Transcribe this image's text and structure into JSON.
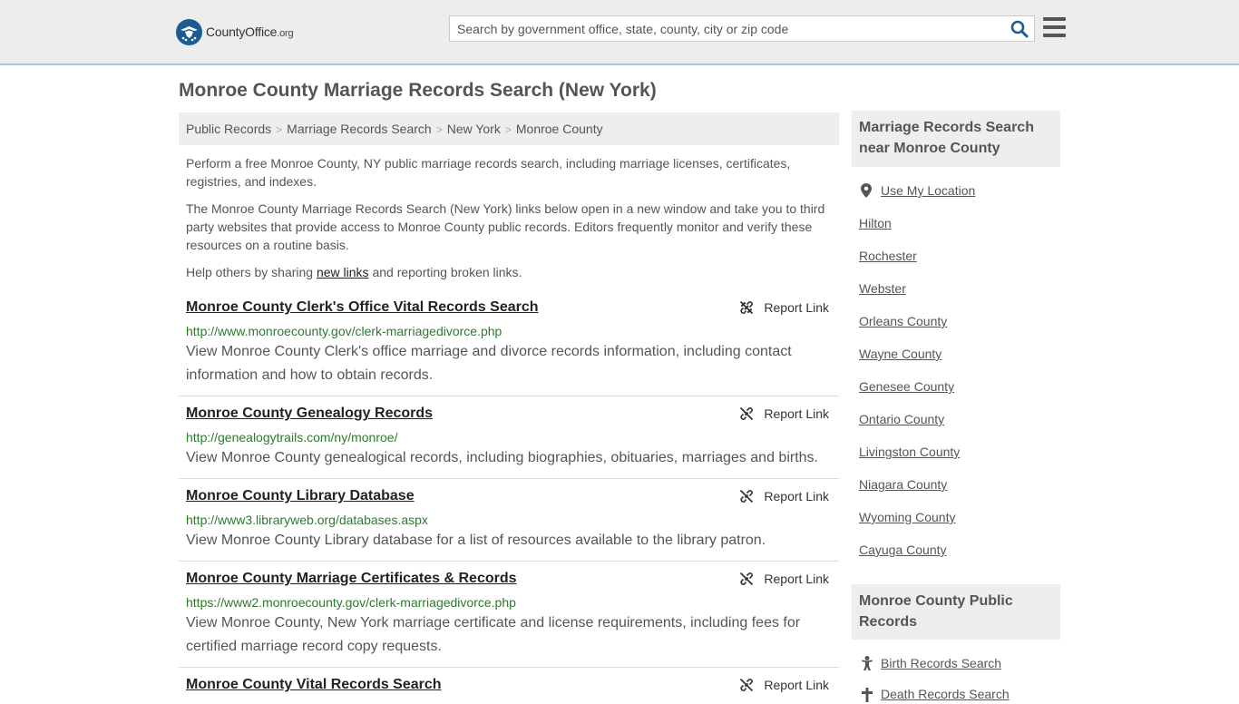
{
  "header": {
    "logo_main": "CountyOffice",
    "logo_tld": ".org",
    "search_placeholder": "Search by government office, state, county, city or zip code",
    "search_icon": "search-icon",
    "menu_icon": "hamburger-menu-icon"
  },
  "page_title": "Monroe County Marriage Records Search (New York)",
  "breadcrumb": [
    "Public Records",
    "Marriage Records Search",
    "New York",
    "Monroe County"
  ],
  "intro": {
    "p1": "Perform a free Monroe County, NY public marriage records search, including marriage licenses, certificates, registries, and indexes.",
    "p2": "The Monroe County Marriage Records Search (New York) links below open in a new window and take you to third party websites that provide access to Monroe County public records. Editors frequently monitor and verify these resources on a routine basis.",
    "p3_before": "Help others by sharing ",
    "p3_link": "new links",
    "p3_after": " and reporting broken links."
  },
  "report_label": "Report Link",
  "results": [
    {
      "title": "Monroe County Clerk's Office Vital Records Search",
      "url": "http://www.monroecounty.gov/clerk-marriagedivorce.php",
      "desc": "View Monroe County Clerk's office marriage and divorce records information, including contact information and how to obtain records."
    },
    {
      "title": "Monroe County Genealogy Records",
      "url": "http://genealogytrails.com/ny/monroe/",
      "desc": "View Monroe County genealogical records, including biographies, obituaries, marriages and births."
    },
    {
      "title": "Monroe County Library Database",
      "url": "http://www3.libraryweb.org/databases.aspx",
      "desc": "View Monroe County Library database for a list of resources available to the library patron."
    },
    {
      "title": "Monroe County Marriage Certificates & Records",
      "url": "https://www2.monroecounty.gov/clerk-marriagedivorce.php",
      "desc": "View Monroe County, New York marriage certificate and license requirements, including fees for certified marriage record copy requests."
    },
    {
      "title": "Monroe County Vital Records Search",
      "url": "",
      "desc": ""
    }
  ],
  "sidebar": {
    "nearby_heading": "Marriage Records Search near Monroe County",
    "use_location": "Use My Location",
    "nearby": [
      "Hilton",
      "Rochester",
      "Webster",
      "Orleans County",
      "Wayne County",
      "Genesee County",
      "Ontario County",
      "Livingston County",
      "Niagara County",
      "Wyoming County",
      "Cayuga County"
    ],
    "public_heading": "Monroe County Public Records",
    "public_links": [
      "Birth Records Search",
      "Death Records Search"
    ]
  },
  "colors": {
    "header_bg": "#ededed",
    "logo_blue": "#1d5b95",
    "url_green": "#2f7a2f",
    "search_icon_blue": "#1d5b95"
  }
}
